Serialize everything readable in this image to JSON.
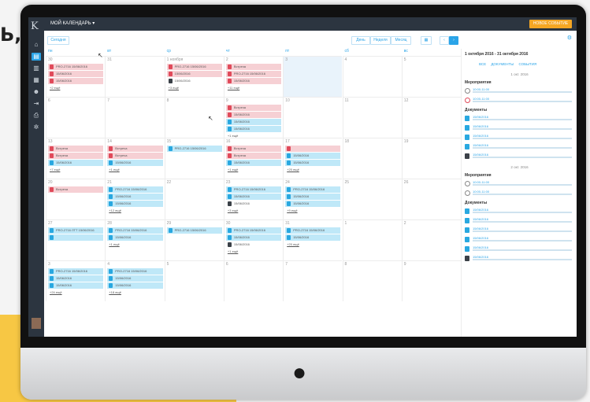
{
  "top_word": "Ь,",
  "colors": {
    "accent": "#2aa4e8",
    "sidebar": "#2c3540",
    "new_event": "#f5a623",
    "event_red": "#f6d0d4",
    "event_blue": "#bfe8f8"
  },
  "app": {
    "logo": "K",
    "calendar_title": "МОЙ КАЛЕНДАРЬ ▾",
    "new_event_label": "НОВОЕ СОБЫТИЕ"
  },
  "sidebar_icons": [
    "home-icon",
    "document-icon",
    "chart-icon",
    "calendar-icon",
    "users-icon",
    "logout-icon",
    "printer-icon",
    "settings-icon"
  ],
  "toolbar": {
    "today": "Сегодня",
    "day": "День",
    "week": "Неделя",
    "month": "Месяц",
    "calendar_icon": "▦",
    "prev": "‹",
    "next": "›"
  },
  "weekdays": [
    "пн",
    "вт",
    "ср",
    "чт",
    "пт",
    "сб",
    "вс"
  ],
  "weeks": [
    {
      "days": [
        {
          "num": "30",
          "events": [
            {
              "c": "red",
              "t": "PRO-2716 15/06/2016"
            },
            {
              "c": "red",
              "t": "15/06/2016"
            },
            {
              "c": "red",
              "t": "15/06/2016"
            }
          ],
          "more": "+2 ещё"
        },
        {
          "num": "31",
          "events": [],
          "more": ""
        },
        {
          "num": "1 ноября",
          "events": [
            {
              "c": "red",
              "t": "PRO-2716 15/06/2016"
            },
            {
              "c": "red",
              "t": "15/06/2016"
            },
            {
              "c": "dark",
              "t": "15/06/2016"
            }
          ],
          "more": "+3 ещё"
        },
        {
          "num": "2",
          "events": [
            {
              "c": "red",
              "t": "Встреча"
            },
            {
              "c": "red",
              "t": "PRO-2716 15/06/2016"
            },
            {
              "c": "red",
              "t": "15/06/2016"
            }
          ],
          "more": "+11 ещё"
        },
        {
          "num": "3",
          "events": [],
          "more": "",
          "hl": true
        },
        {
          "num": "4",
          "events": [],
          "more": ""
        },
        {
          "num": "5",
          "events": [],
          "more": ""
        }
      ]
    },
    {
      "days": [
        {
          "num": "6",
          "events": [],
          "more": ""
        },
        {
          "num": "7",
          "events": [],
          "more": ""
        },
        {
          "num": "8",
          "events": [],
          "more": ""
        },
        {
          "num": "9",
          "events": [
            {
              "c": "red",
              "t": "Встреча"
            },
            {
              "c": "red",
              "t": "15/06/2016"
            },
            {
              "c": "blue",
              "t": "15/06/2016"
            },
            {
              "c": "blue",
              "t": "15/06/2016"
            }
          ],
          "more": "+1 ещё"
        },
        {
          "num": "10",
          "events": [],
          "more": ""
        },
        {
          "num": "11",
          "events": [],
          "more": ""
        },
        {
          "num": "12",
          "events": [],
          "more": ""
        }
      ]
    },
    {
      "days": [
        {
          "num": "13",
          "events": [
            {
              "c": "red",
              "t": "Встреча"
            },
            {
              "c": "red",
              "t": "Встреча"
            },
            {
              "c": "blue",
              "t": "15/06/2016"
            }
          ],
          "more": "+7 ещё"
        },
        {
          "num": "14",
          "events": [
            {
              "c": "red",
              "t": "Встреча"
            },
            {
              "c": "red",
              "t": "Встреча"
            },
            {
              "c": "blue",
              "t": "15/06/2016"
            }
          ],
          "more": "+1 ещё"
        },
        {
          "num": "15",
          "events": [
            {
              "c": "blue",
              "t": "PRO-2716 15/06/2016"
            }
          ],
          "more": ""
        },
        {
          "num": "16",
          "events": [
            {
              "c": "red",
              "t": "Встреча"
            },
            {
              "c": "red",
              "t": "Встреча"
            },
            {
              "c": "blue",
              "t": "15/06/2016"
            }
          ],
          "more": "+1 ещё"
        },
        {
          "num": "17",
          "events": [
            {
              "c": "red",
              "t": ""
            },
            {
              "c": "blue",
              "t": "15/06/2016"
            },
            {
              "c": "blue",
              "t": "15/06/2016"
            }
          ],
          "more": "+20 ещё"
        },
        {
          "num": "18",
          "events": [],
          "more": ""
        },
        {
          "num": "19",
          "events": [],
          "more": ""
        }
      ]
    },
    {
      "days": [
        {
          "num": "20",
          "events": [
            {
              "c": "red",
              "t": "Встреча"
            }
          ],
          "more": ""
        },
        {
          "num": "21",
          "events": [
            {
              "c": "blue",
              "t": "PRO-2716 15/06/2016"
            },
            {
              "c": "blue",
              "t": "15/06/2016"
            },
            {
              "c": "blue",
              "t": "15/06/2016"
            }
          ],
          "more": "+12 ещё"
        },
        {
          "num": "22",
          "events": [],
          "more": ""
        },
        {
          "num": "23",
          "events": [
            {
              "c": "blue",
              "t": "PRO-2716 15/06/2016"
            },
            {
              "c": "blue",
              "t": "15/06/2016"
            },
            {
              "c": "dark",
              "t": "15/06/2016"
            }
          ],
          "more": "+3 ещё"
        },
        {
          "num": "24",
          "events": [
            {
              "c": "blue",
              "t": "PRO-2716 15/06/2016"
            },
            {
              "c": "blue",
              "t": "15/06/2016"
            },
            {
              "c": "blue",
              "t": "15/06/2016"
            }
          ],
          "more": "+9 ещё"
        },
        {
          "num": "25",
          "events": [],
          "more": ""
        },
        {
          "num": "26",
          "events": [],
          "more": ""
        }
      ]
    },
    {
      "days": [
        {
          "num": "27",
          "events": [
            {
              "c": "blue",
              "t": "PRO-2716 ЛТТ 15/06/2016"
            },
            {
              "c": "blue",
              "t": ""
            }
          ],
          "more": ""
        },
        {
          "num": "28",
          "events": [
            {
              "c": "blue",
              "t": "PRO-2716 15/06/2016"
            },
            {
              "c": "blue",
              "t": "15/06/2016"
            }
          ],
          "more": "+1 ещё"
        },
        {
          "num": "29",
          "events": [
            {
              "c": "blue",
              "t": "PRO-2716 15/06/2016"
            }
          ],
          "more": ""
        },
        {
          "num": "30",
          "events": [
            {
              "c": "blue",
              "t": "PRO-2716 15/06/2016"
            },
            {
              "c": "blue",
              "t": "15/06/2016"
            },
            {
              "c": "dark",
              "t": "15/06/2016"
            }
          ],
          "more": "+1 ещё"
        },
        {
          "num": "31",
          "events": [
            {
              "c": "blue",
              "t": "PRO-2716 15/06/2016"
            },
            {
              "c": "blue",
              "t": "15/06/2016"
            }
          ],
          "more": "+20 ещё"
        },
        {
          "num": "1",
          "events": [],
          "more": ""
        },
        {
          "num": "2",
          "events": [],
          "more": ""
        }
      ]
    },
    {
      "days": [
        {
          "num": "3",
          "events": [
            {
              "c": "blue",
              "t": "PRO-2716 15/06/2016"
            },
            {
              "c": "blue",
              "t": "15/06/2016"
            },
            {
              "c": "blue",
              "t": "15/06/2016"
            }
          ],
          "more": "+24 ещё"
        },
        {
          "num": "4",
          "events": [
            {
              "c": "blue",
              "t": "PRO-2716 15/06/2016"
            },
            {
              "c": "blue",
              "t": "15/06/2016"
            },
            {
              "c": "blue",
              "t": "15/06/2016"
            }
          ],
          "more": "+18 ещё"
        },
        {
          "num": "5",
          "events": [],
          "more": ""
        },
        {
          "num": "6",
          "events": [],
          "more": ""
        },
        {
          "num": "7",
          "events": [],
          "more": ""
        },
        {
          "num": "8",
          "events": [],
          "more": ""
        },
        {
          "num": "9",
          "events": [],
          "more": ""
        }
      ]
    }
  ],
  "side": {
    "range": "1 октября 2016 - 31 октября 2016",
    "tabs": [
      "ВСЕ",
      "ДОКУМЕНТЫ",
      "СОБЫТИЯ"
    ],
    "day1": "1 окт. 2016",
    "events_title": "Мероприятия",
    "docs_title": "Документы",
    "day2": "2 окт. 2016",
    "block1_events": [
      {
        "t": "10:00-11:00",
        "k": "clockg"
      },
      {
        "t": "10:00-11:00",
        "k": "clock"
      }
    ],
    "block1_docs": [
      {
        "t": "15/06/2016",
        "k": ""
      },
      {
        "t": "15/06/2016",
        "k": ""
      },
      {
        "t": "15/06/2016",
        "k": ""
      },
      {
        "t": "15/06/2016",
        "k": ""
      },
      {
        "t": "15/06/2016",
        "k": "d"
      }
    ],
    "block2_events": [
      {
        "t": "10:00-11:00",
        "k": "clockg"
      },
      {
        "t": "10:00-11:00",
        "k": "clockg"
      }
    ],
    "block2_docs": [
      {
        "t": "15/06/2016",
        "k": ""
      },
      {
        "t": "15/06/2016",
        "k": ""
      },
      {
        "t": "15/06/2016",
        "k": ""
      },
      {
        "t": "15/06/2016",
        "k": ""
      },
      {
        "t": "15/06/2016",
        "k": ""
      },
      {
        "t": "15/06/2016",
        "k": "d"
      }
    ]
  }
}
